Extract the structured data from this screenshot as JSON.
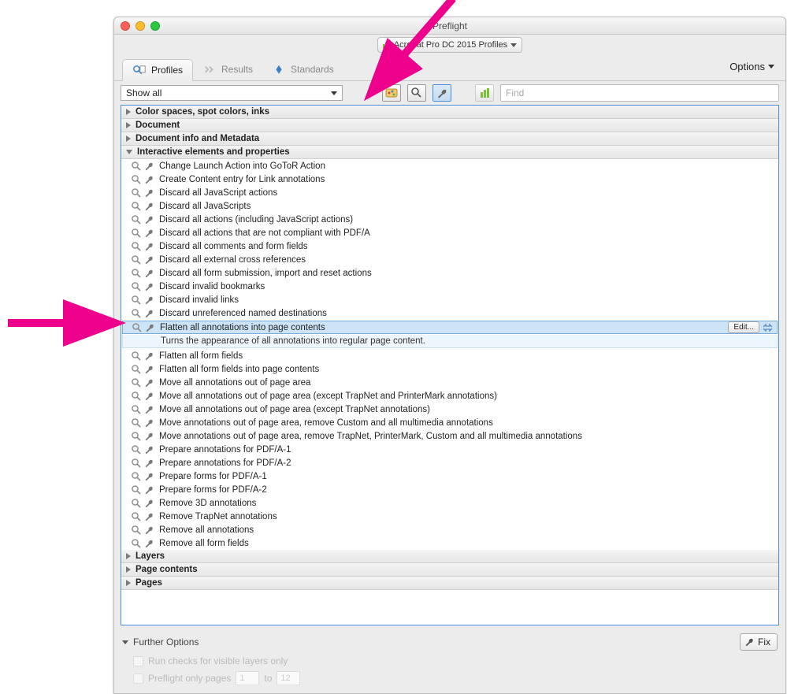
{
  "titlebar": {
    "title": "Preflight"
  },
  "profileSelector": {
    "label": "Acrobat Pro DC 2015 Profiles"
  },
  "tabs": {
    "profiles": "Profiles",
    "results": "Results",
    "standards": "Standards"
  },
  "optionsMenu": "Options",
  "toolbar": {
    "showAllLabel": "Show all",
    "findPlaceholder": "Find"
  },
  "groups": {
    "colorSpaces": "Color spaces, spot colors, inks",
    "document": "Document",
    "docInfo": "Document info and Metadata",
    "interactive": "Interactive elements and properties",
    "layers": "Layers",
    "pageContents": "Page contents",
    "pages": "Pages"
  },
  "items": [
    "Change Launch Action into GoToR Action",
    "Create Content entry for Link annotations",
    "Discard all JavaScript actions",
    "Discard all JavaScripts",
    "Discard all actions (including JavaScript actions)",
    "Discard all actions that are not compliant with PDF/A",
    "Discard all comments and form fields",
    "Discard all external cross references",
    "Discard all form submission, import and reset actions",
    "Discard invalid bookmarks",
    "Discard invalid links",
    "Discard unreferenced named destinations",
    "Flatten all annotations into page contents",
    "Flatten all form fields",
    "Flatten all form fields into page contents",
    "Move all annotations out of page area",
    "Move all annotations out of page area (except TrapNet and PrinterMark annotations)",
    "Move all annotations out of page area (except TrapNet annotations)",
    "Move annotations out of page area, remove Custom and all multimedia annotations",
    "Move annotations out of page area, remove TrapNet, PrinterMark, Custom and all multimedia annotations",
    "Prepare annotations for PDF/A-1",
    "Prepare annotations for PDF/A-2",
    "Prepare forms for PDF/A-1",
    "Prepare forms for PDF/A-2",
    "Remove 3D annotations",
    "Remove TrapNet annotations",
    "Remove all annotations",
    "Remove all form fields"
  ],
  "selectedIndex": 12,
  "selectedDescription": "Turns the appearance of all annotations into regular page content.",
  "editButton": "Edit...",
  "footer": {
    "further": "Further Options",
    "fix": "Fix",
    "runChecks": "Run checks for visible layers only",
    "preflightOnly": "Preflight only pages",
    "pageFrom": "1",
    "pageTo": "12",
    "toLabel": "to"
  }
}
